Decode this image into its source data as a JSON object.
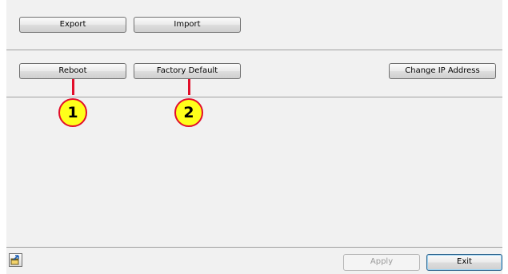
{
  "top_row": {
    "export_label": "Export",
    "import_label": "Import"
  },
  "middle_row": {
    "reboot_label": "Reboot",
    "factory_default_label": "Factory Default",
    "change_ip_label": "Change IP Address"
  },
  "callouts": {
    "first": "1",
    "second": "2"
  },
  "footer": {
    "apply_label": "Apply",
    "exit_label": "Exit",
    "corner_icon": "export-window-icon"
  },
  "colors": {
    "panel_bg": "#f1f1f1",
    "callout_fill": "#ffff1a",
    "callout_border": "#e20e2a"
  }
}
